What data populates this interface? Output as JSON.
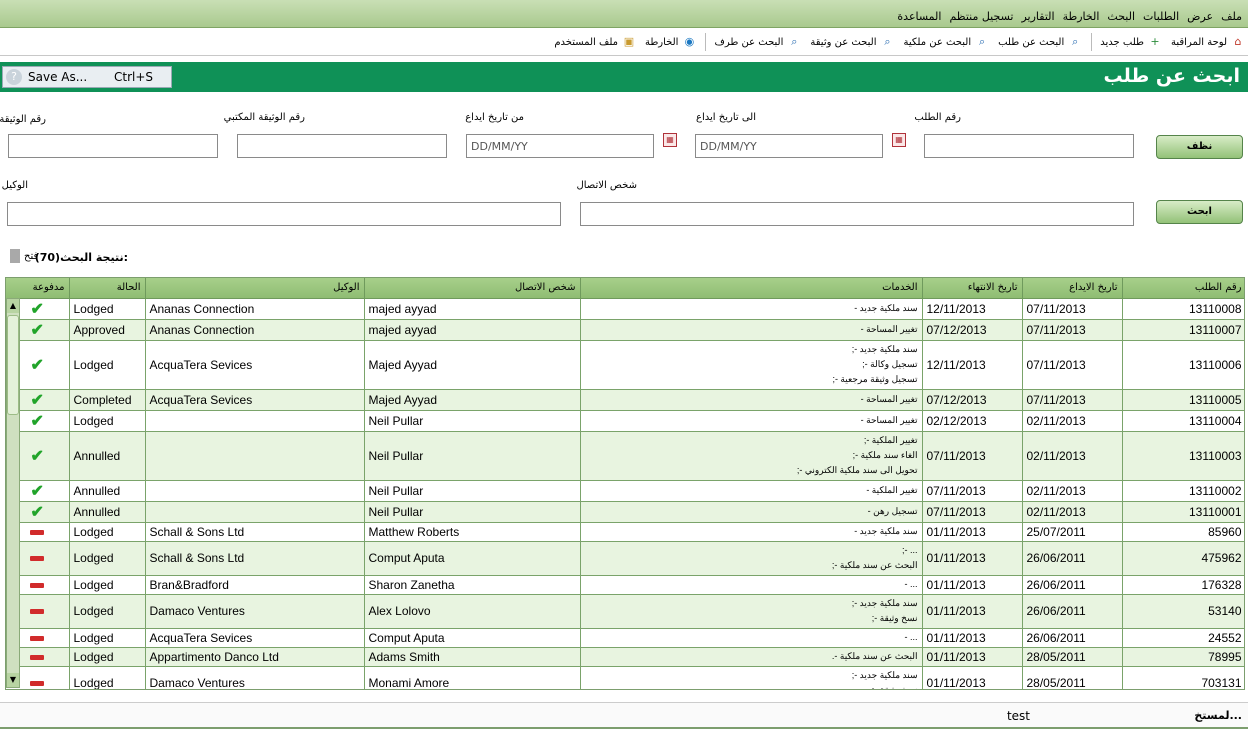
{
  "menu": [
    "ملف",
    "عرض",
    "الطلبات",
    "البحث",
    "الخارطة",
    "التقارير",
    "تسجيل منتظم",
    "المساعدة"
  ],
  "toolbar": [
    {
      "label": "لوحة المراقبة",
      "icon": "home-icon"
    },
    {
      "label": "طلب جديد",
      "icon": "new-document-icon"
    },
    {
      "label": "البحث عن طلب",
      "icon": "search-icon"
    },
    {
      "label": "البحث عن ملكية",
      "icon": "search-icon"
    },
    {
      "label": "البحث عن وثيقة",
      "icon": "search-icon"
    },
    {
      "label": "البحث عن طرف",
      "icon": "search-icon"
    },
    {
      "label": "الخارطة",
      "icon": "globe-icon"
    },
    {
      "label": "ملف المستخدم",
      "icon": "user-profile-icon"
    }
  ],
  "save_as": {
    "label": "Save As...",
    "shortcut": "Ctrl+S"
  },
  "page_title": "ابحث عن طلب",
  "form": {
    "request_no_label": "رقم الطلب",
    "to_date_label": "الى  تاريخ ايداع",
    "to_date_placeholder": "DD/MM/YY",
    "from_date_label": "من تاريخ ايداع",
    "from_date_placeholder": "DD/MM/YY",
    "office_doc_label": "رقم الوثيقة المكتبي",
    "doc_no_label": "رقم الوثيقة",
    "contact_label": "شخص الاتصال",
    "agent_label": "الوكيل",
    "clear_button": "نظف",
    "search_button": "ابحث"
  },
  "results": {
    "label": "نتيجة البحث:",
    "count": "(70)",
    "open_label": "فتح"
  },
  "table": {
    "headers": {
      "request": "رقم الطلب",
      "deposit": "تاريخ الايداع",
      "expiry": "تاريخ الانتهاء",
      "services": "الخدمات",
      "contact": "شخص الاتصال",
      "agent": "الوكيل",
      "status": "الحالة",
      "paid": "مدفوعة"
    },
    "rows": [
      {
        "paid": "yes",
        "status": "Lodged",
        "agent": "Ananas Connection",
        "contact": "majed ayyad",
        "services": [
          "سند ملكية جديد -"
        ],
        "expiry": "12/11/2013",
        "deposit": "07/11/2013",
        "request": "13110008"
      },
      {
        "paid": "yes",
        "status": "Approved",
        "agent": "Ananas Connection",
        "contact": "majed ayyad",
        "services": [
          "تغيير المساحة -"
        ],
        "expiry": "07/12/2013",
        "deposit": "07/11/2013",
        "request": "13110007"
      },
      {
        "paid": "yes",
        "status": "Lodged",
        "agent": "AcquaTera Sevices",
        "contact": "Majed Ayyad",
        "services": [
          "سند ملكية جديد -;",
          "تسجيل وكالة -;",
          "تسجيل وثيقة مرجعية -;"
        ],
        "expiry": "12/11/2013",
        "deposit": "07/11/2013",
        "request": "13110006"
      },
      {
        "paid": "yes",
        "status": "Completed",
        "agent": "AcquaTera Sevices",
        "contact": "Majed Ayyad",
        "services": [
          "تغيير المساحة -"
        ],
        "expiry": "07/12/2013",
        "deposit": "07/11/2013",
        "request": "13110005"
      },
      {
        "paid": "yes",
        "status": "Lodged",
        "agent": "",
        "contact": "Neil Pullar",
        "services": [
          "تغيير المساحة -"
        ],
        "expiry": "02/12/2013",
        "deposit": "02/11/2013",
        "request": "13110004"
      },
      {
        "paid": "yes",
        "status": "Annulled",
        "agent": "",
        "contact": "Neil Pullar",
        "services": [
          "تغيير الملكية -;",
          "الغاء سند ملكية -;",
          "تحويل الى سند ملكية الكتروني -;"
        ],
        "expiry": "07/11/2013",
        "deposit": "02/11/2013",
        "request": "13110003"
      },
      {
        "paid": "yes",
        "status": "Annulled",
        "agent": "",
        "contact": "Neil Pullar",
        "services": [
          "تغيير الملكية -"
        ],
        "expiry": "07/11/2013",
        "deposit": "02/11/2013",
        "request": "13110002"
      },
      {
        "paid": "yes",
        "status": "Annulled",
        "agent": "",
        "contact": "Neil Pullar",
        "services": [
          "تسجيل رهن -"
        ],
        "expiry": "07/11/2013",
        "deposit": "02/11/2013",
        "request": "13110001"
      },
      {
        "paid": "no",
        "status": "Lodged",
        "agent": "Schall & Sons Ltd",
        "contact": "Matthew Roberts",
        "services": [
          "سند ملكية جديد -"
        ],
        "expiry": "01/11/2013",
        "deposit": "25/07/2011",
        "request": "85960"
      },
      {
        "paid": "no",
        "status": "Lodged",
        "agent": "Schall & Sons Ltd",
        "contact": "Comput Aputa",
        "services": [
          "... -;",
          "البحث عن سند ملكية -;"
        ],
        "expiry": "01/11/2013",
        "deposit": "26/06/2011",
        "request": "475962"
      },
      {
        "paid": "no",
        "status": "Lodged",
        "agent": "Bran&Bradford",
        "contact": "Sharon Zanetha",
        "services": [
          "... -"
        ],
        "expiry": "01/11/2013",
        "deposit": "26/06/2011",
        "request": "176328"
      },
      {
        "paid": "no",
        "status": "Lodged",
        "agent": "Damaco Ventures",
        "contact": "Alex Lolovo",
        "services": [
          "سند ملكية جديد -;",
          "نسخ وثيقة -;"
        ],
        "expiry": "01/11/2013",
        "deposit": "26/06/2011",
        "request": "53140"
      },
      {
        "paid": "no",
        "status": "Lodged",
        "agent": "AcquaTera Sevices",
        "contact": "Comput Aputa",
        "services": [
          "... -"
        ],
        "expiry": "01/11/2013",
        "deposit": "26/06/2011",
        "request": "24552"
      },
      {
        "paid": "no",
        "status": "Lodged",
        "agent": "Appartimento Danco Ltd",
        "contact": "Adams Smith",
        "services": [
          "البحث عن سند ملكية -."
        ],
        "expiry": "01/11/2013",
        "deposit": "28/05/2011",
        "request": "78995"
      },
      {
        "paid": "no",
        "status": "Lodged",
        "agent": "Damaco Ventures",
        "contact": "Monami Amore",
        "services": [
          "سند ملكية جديد -;",
          "نسخ وثيقة -;"
        ],
        "expiry": "01/11/2013",
        "deposit": "28/05/2011",
        "request": "703131"
      }
    ]
  },
  "status": {
    "user_label": "لمستخ...",
    "user": "test"
  },
  "colors": {
    "header_green": "#0f9157",
    "check_green": "#21a42a",
    "dash_red": "#d12b2b"
  }
}
